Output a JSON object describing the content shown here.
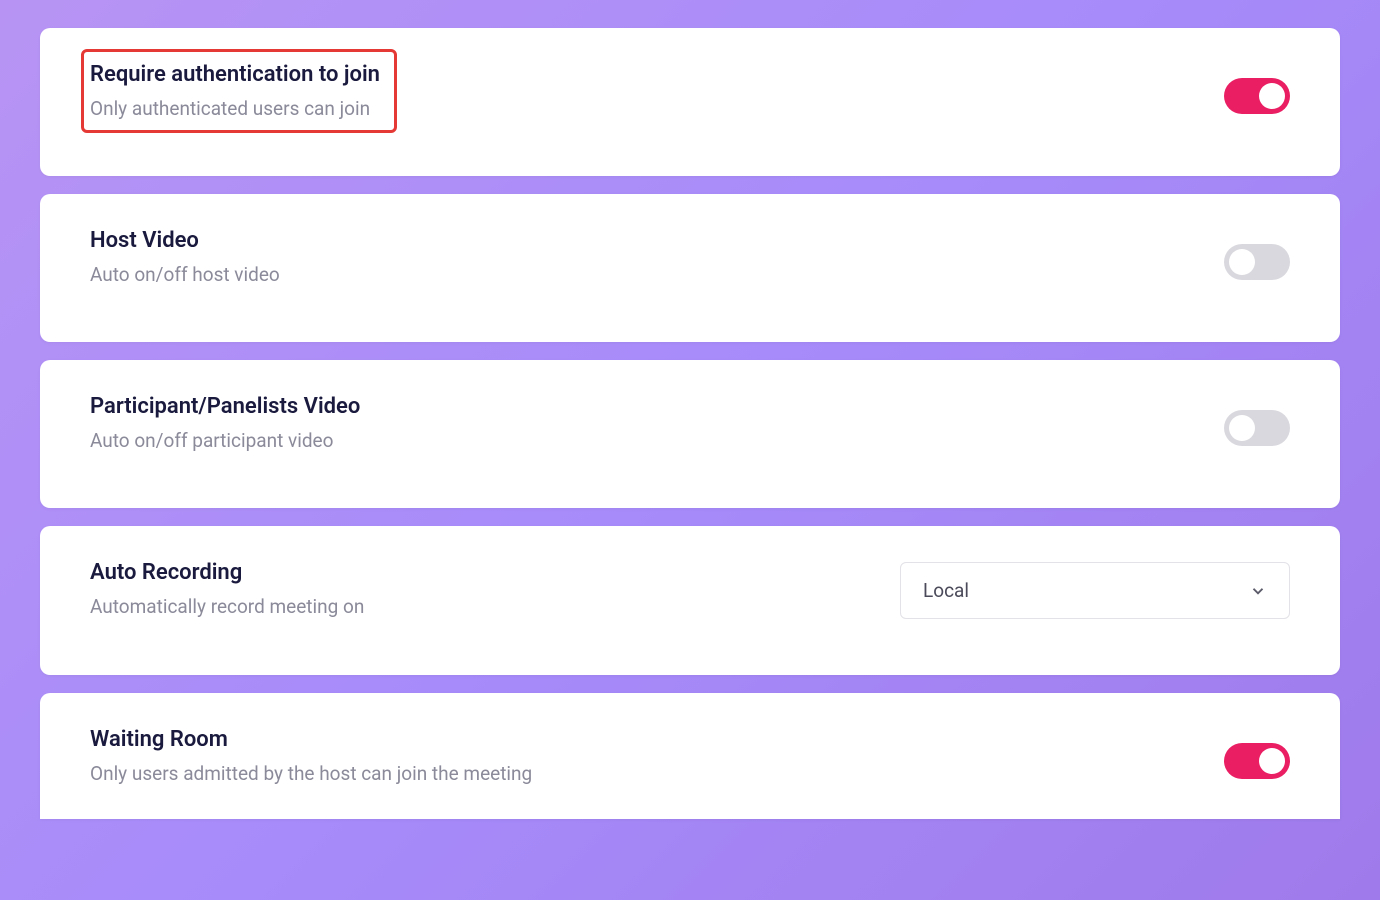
{
  "settings": {
    "authentication": {
      "title": "Require authentication to join",
      "description": "Only authenticated users can join",
      "enabled": true,
      "highlighted": true
    },
    "host_video": {
      "title": "Host Video",
      "description": "Auto on/off host video",
      "enabled": false
    },
    "participant_video": {
      "title": "Participant/Panelists Video",
      "description": "Auto on/off participant video",
      "enabled": false
    },
    "auto_recording": {
      "title": "Auto Recording",
      "description": "Automatically record meeting on",
      "selected": "Local"
    },
    "waiting_room": {
      "title": "Waiting Room",
      "description": "Only users admitted by the host can join the meeting",
      "enabled": true
    }
  }
}
